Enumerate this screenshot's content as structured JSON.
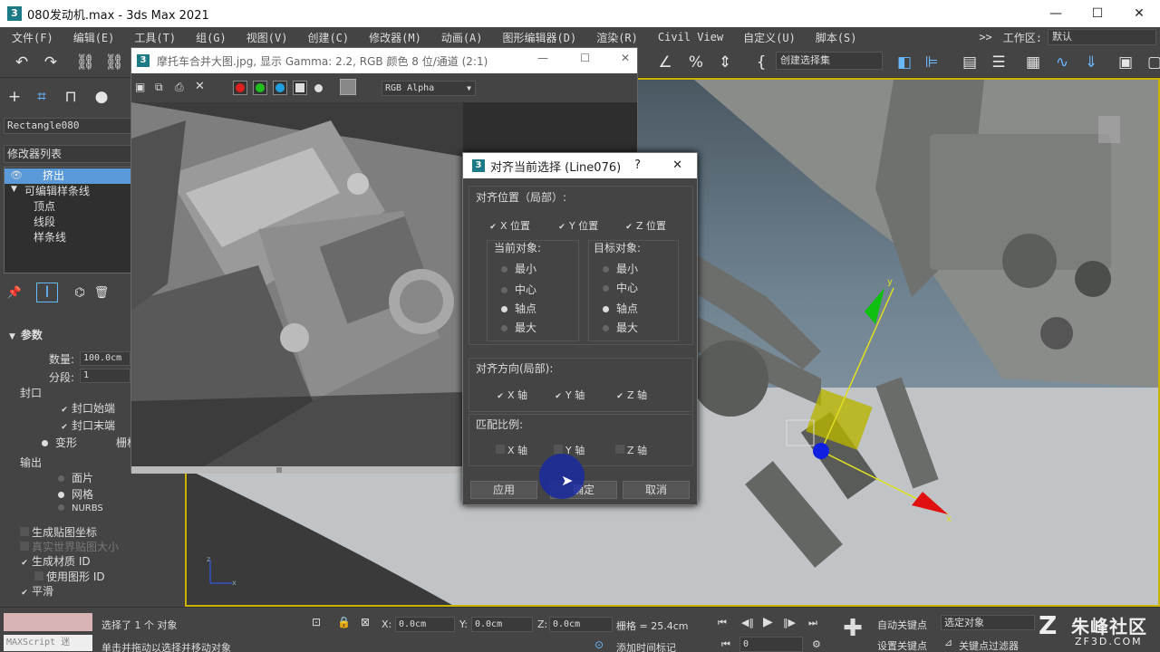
{
  "window": {
    "title": "080发动机.max - 3ds Max 2021",
    "logo": "3",
    "min": "—",
    "max": "☐",
    "close": "✕"
  },
  "menu": [
    "文件(F)",
    "编辑(E)",
    "工具(T)",
    "组(G)",
    "视图(V)",
    "创建(C)",
    "修改器(M)",
    "动画(A)",
    "图形编辑器(D)",
    "渲染(R)",
    "Civil View",
    "自定义(U)",
    "脚本(S)"
  ],
  "workspace": {
    "label": "工作区:",
    "value": "默认",
    "arrows": ">>"
  },
  "toolbar": {
    "selection_set": "创建选择集"
  },
  "left": {
    "object_name": "Rectangle080",
    "modifier_list": "修改器列表",
    "stack": [
      {
        "label": "挤出",
        "selected": true
      },
      {
        "label": "可编辑样条线",
        "selected": false
      },
      {
        "label": "顶点",
        "selected": false
      },
      {
        "label": "线段",
        "selected": false
      },
      {
        "label": "样条线",
        "selected": false
      }
    ],
    "params_title": "参数",
    "amount_label": "数量:",
    "amount_value": "100.0cm",
    "segments_label": "分段:",
    "segments_value": "1",
    "capping": "封口",
    "cap_start": "封口始端",
    "cap_end": "封口末端",
    "morph": "变形",
    "grid": "栅格",
    "output": "输出",
    "patch": "面片",
    "mesh": "网格",
    "nurbs": "NURBS",
    "gen_map": "生成贴图坐标",
    "real_world": "真实世界贴图大小",
    "gen_mat": "生成材质 ID",
    "use_shape": "使用图形 ID",
    "smooth": "平滑"
  },
  "image_viewer": {
    "title": "摩托车合并大图.jpg, 显示 Gamma: 2.2, RGB 颜色 8 位/通道 (2:1)",
    "channel": "RGB Alpha",
    "logo": "3"
  },
  "dialog": {
    "title": "对齐当前选择 (Line076)",
    "help": "?",
    "close": "✕",
    "logo": "3",
    "align_pos": "对齐位置（局部）:",
    "x_pos": "X 位置",
    "y_pos": "Y 位置",
    "z_pos": "Z 位置",
    "current": "当前对象:",
    "target": "目标对象:",
    "options": [
      "最小",
      "中心",
      "轴点",
      "最大"
    ],
    "current_selected": "轴点",
    "target_selected": "轴点",
    "align_orient": "对齐方向(局部):",
    "x_axis": "X 轴",
    "y_axis": "Y 轴",
    "z_axis": "Z 轴",
    "match_scale": "匹配比例:",
    "apply": "应用",
    "ok": "确定",
    "cancel": "取消"
  },
  "status": {
    "maxscript": "MAXScript 迷",
    "selected": "选择了 1 个 对象",
    "hint": "单击并拖动以选择并移动对象",
    "x_label": "X:",
    "x_value": "0.0cm",
    "y_label": "Y:",
    "y_value": "0.0cm",
    "z_label": "Z:",
    "z_value": "0.0cm",
    "grid": "栅格 = 25.4cm",
    "add_time_tag": "添加时间标记",
    "auto_key": "自动关键点",
    "set_key": "设置关键点",
    "selected_obj": "选定对象",
    "key_filter": "关键点过滤器",
    "frame": "0"
  },
  "watermark": {
    "brand": "朱峰社区",
    "site": "ZF3D.COM"
  },
  "colors": {
    "accent": "#5a9ad8",
    "viewport_border": "#c8b400",
    "gizmo_x": "#e01010",
    "gizmo_y": "#10c010",
    "gizmo_z": "#1020e0"
  }
}
